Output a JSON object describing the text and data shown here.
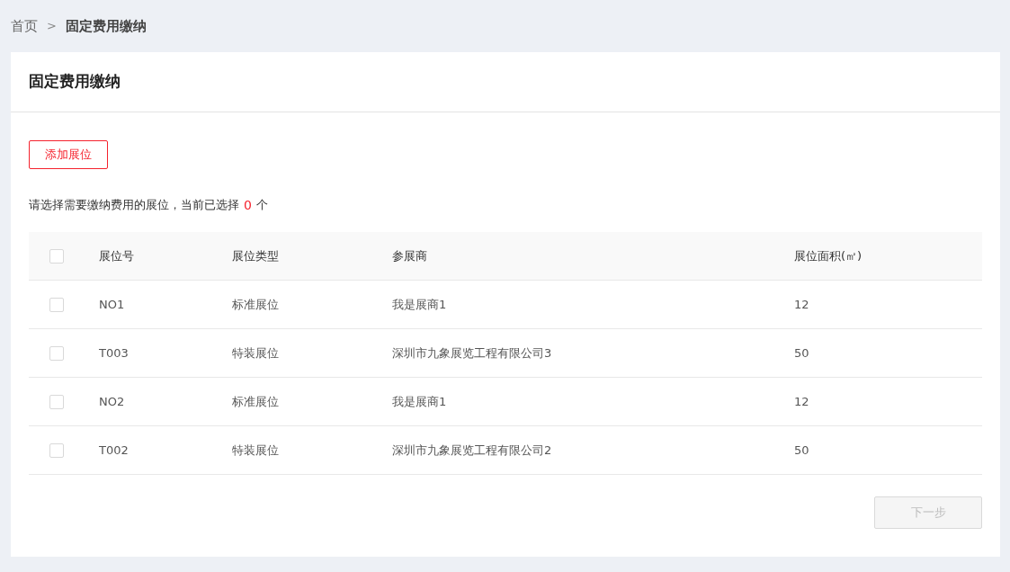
{
  "breadcrumb": [
    {
      "label": "首页",
      "current": false
    },
    {
      "label": "固定费用缴纳",
      "current": true
    }
  ],
  "breadcrumb_separator": ">",
  "card": {
    "title": "固定费用缴纳"
  },
  "add_button": "添加展位",
  "selection_hint": {
    "prefix": "请选择需要缴纳费用的展位，当前已选择",
    "count": "0",
    "suffix": "个"
  },
  "table": {
    "select_all": {
      "checked": false
    },
    "columns": [
      "展位号",
      "展位类型",
      "参展商",
      "展位面积(㎡)"
    ],
    "rows": [
      {
        "checked": false,
        "cells": [
          "NO1",
          "标准展位",
          "我是展商1",
          "12"
        ]
      },
      {
        "checked": false,
        "cells": [
          "T003",
          "特装展位",
          "深圳市九象展览工程有限公司3",
          "50"
        ]
      },
      {
        "checked": false,
        "cells": [
          "NO2",
          "标准展位",
          "我是展商1",
          "12"
        ]
      },
      {
        "checked": false,
        "cells": [
          "T002",
          "特装展位",
          "深圳市九象展览工程有限公司2",
          "50"
        ]
      }
    ]
  },
  "next_button": {
    "label": "下一步",
    "disabled": true
  }
}
